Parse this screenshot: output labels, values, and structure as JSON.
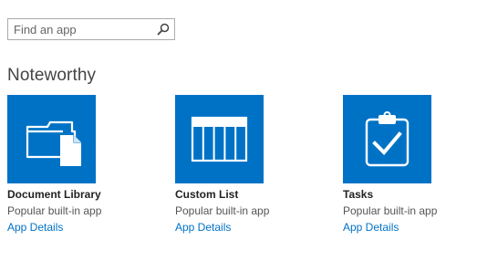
{
  "search": {
    "placeholder": "Find an app",
    "icon": "search-icon"
  },
  "section": {
    "title": "Noteworthy"
  },
  "accent_color": "#0072c6",
  "apps": [
    {
      "name": "Document Library",
      "description": "Popular built-in app",
      "details_label": "App Details",
      "icon": "document-library-icon"
    },
    {
      "name": "Custom List",
      "description": "Popular built-in app",
      "details_label": "App Details",
      "icon": "custom-list-icon"
    },
    {
      "name": "Tasks",
      "description": "Popular built-in app",
      "details_label": "App Details",
      "icon": "tasks-clipboard-icon"
    }
  ]
}
